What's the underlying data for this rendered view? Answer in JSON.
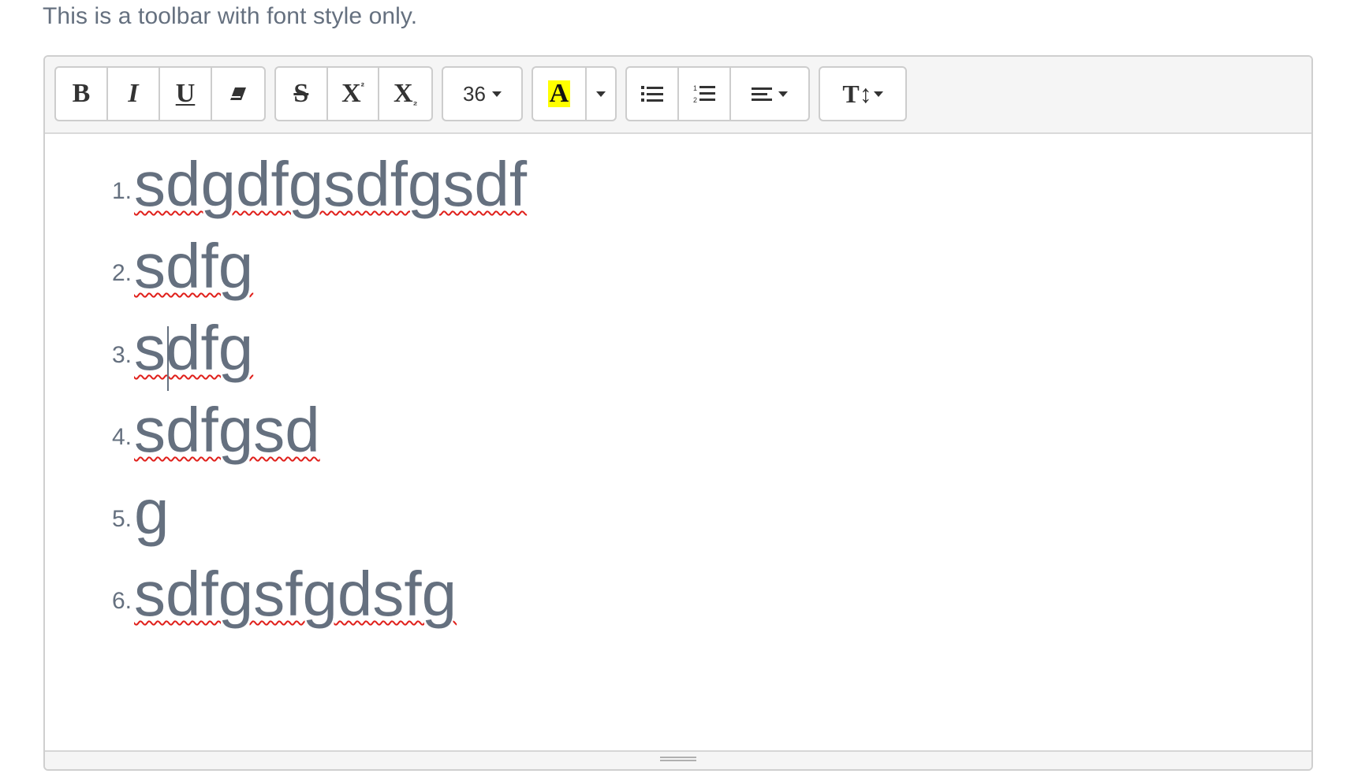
{
  "heading": "This is a toolbar with font style only.",
  "toolbar": {
    "bold": "B",
    "italic": "I",
    "underline": "U",
    "strikethrough": "S",
    "superscript_base": "X",
    "superscript_mark": "²",
    "subscript_base": "X",
    "subscript_mark": "₂",
    "font_size": "36",
    "highlight_letter": "A",
    "highlight_color": "#ffff00",
    "line_height_label": "T↕"
  },
  "content": {
    "items": [
      {
        "number": "1.",
        "text": "sdgdfgsdfgsdf"
      },
      {
        "number": "2.",
        "text": "sdfg"
      },
      {
        "number": "3.",
        "text": "sdfg"
      },
      {
        "number": "4.",
        "text": "sdfgsd"
      },
      {
        "number": "5.",
        "text": "g"
      },
      {
        "number": "6.",
        "text": "sdfgsfgdsfg"
      }
    ]
  },
  "colors": {
    "text": "#65707f",
    "spellcheck": "#e0201b",
    "toolbar_bg": "#f5f5f5"
  }
}
